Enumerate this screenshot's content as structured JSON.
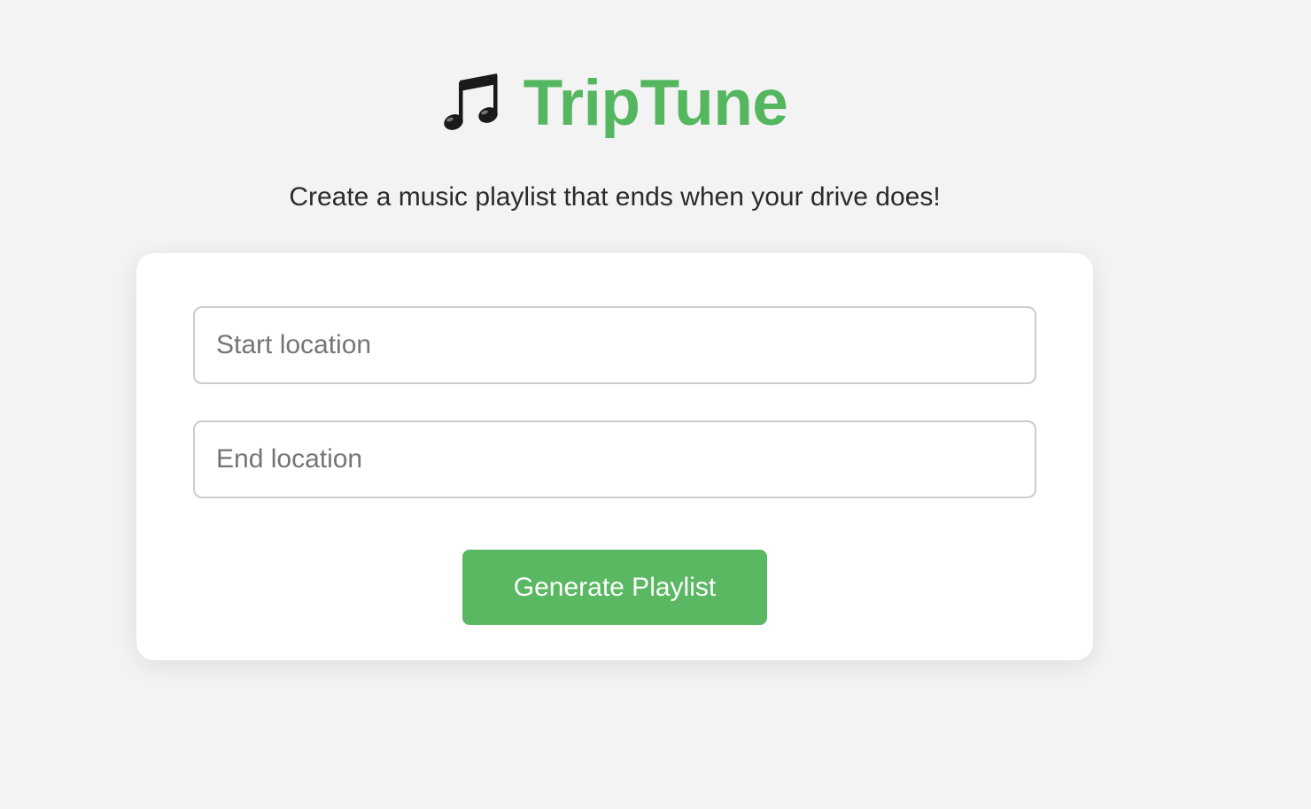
{
  "app": {
    "title": "TripTune",
    "logo_icon": "musical-notes-icon",
    "accent_color": "#55b660"
  },
  "subtitle": "Create a music playlist that ends when your drive does!",
  "form": {
    "start": {
      "placeholder": "Start location",
      "value": ""
    },
    "end": {
      "placeholder": "End location",
      "value": ""
    },
    "submit_label": "Generate Playlist"
  }
}
